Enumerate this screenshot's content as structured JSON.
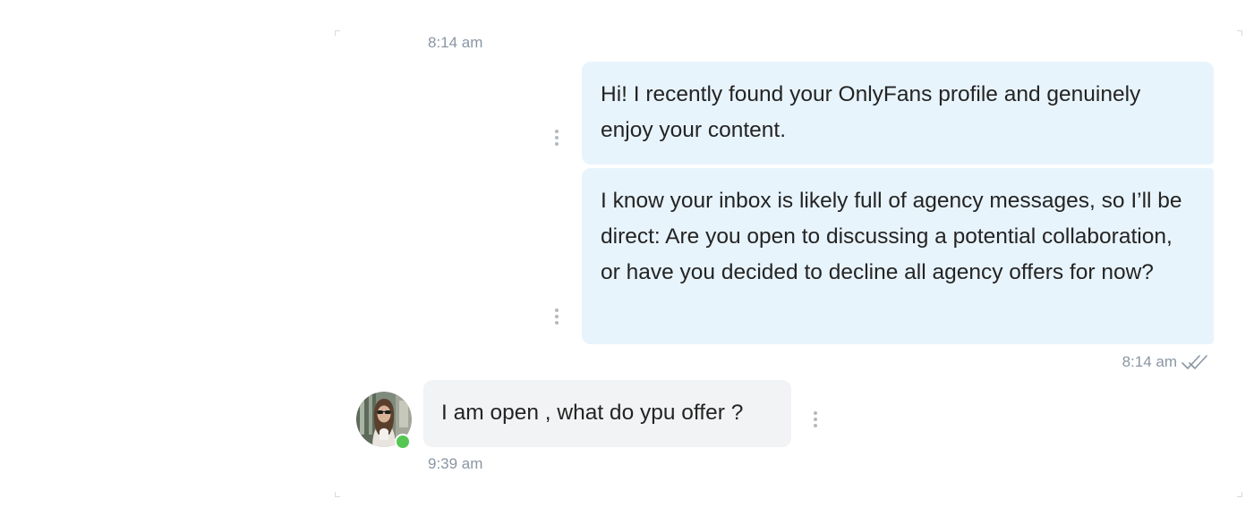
{
  "thread": {
    "clipped_previous_time": "8:14 am",
    "messages": [
      {
        "direction": "outgoing",
        "text": "Hi! I recently found your OnlyFans profile and genuinely enjoy your content."
      },
      {
        "direction": "outgoing",
        "text": "I know your inbox is likely full of agency messages, so I’ll be direct: Are you open to discussing a potential collaboration, or have you decided to decline all agency offers for now?"
      },
      {
        "direction": "incoming",
        "text": "I am open , what do ypu offer ?"
      }
    ],
    "outgoing_group": {
      "time": "8:14 am",
      "status_icon": "double-check-icon",
      "status": "read"
    },
    "incoming_group": {
      "time": "9:39 am",
      "sender_online": true
    }
  },
  "icons": {
    "message_menu": "more-vertical-icon",
    "read_receipt": "double-check-icon"
  },
  "colors": {
    "outgoing_bubble": "#e8f4fc",
    "incoming_bubble": "#f2f3f4",
    "timestamp": "#8a96a3",
    "online": "#53c752",
    "menu_dots": "#b3b9bf"
  }
}
